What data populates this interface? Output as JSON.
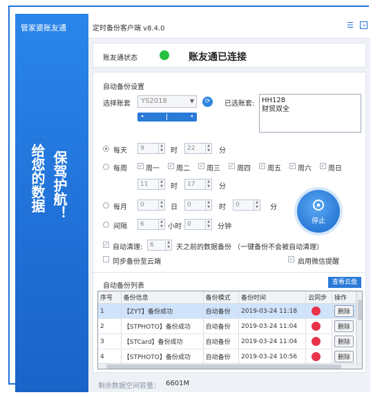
{
  "sidebar": {
    "brand": "管家婆账友通",
    "slogan_left": "给您的数据",
    "slogan_right": "保驾护航！"
  },
  "titlebar": {
    "title": "定时备份客户端 v8.4.0",
    "menu_icon": "menu-icon",
    "minimize_icon": "minimize-to-tray-icon"
  },
  "status": {
    "label": "账友通状态",
    "text": "账友通已连接",
    "color": "#27c03e"
  },
  "backup_settings": {
    "section_label": "自动备份设置",
    "select_account_label": "选择账套",
    "account_value": "YS2018",
    "selected_label": "已选账套:",
    "selected_accounts": [
      "HH128",
      "财贸双全"
    ],
    "daily": {
      "label": "每天",
      "hour": "9",
      "minute": "22",
      "hour_unit": "时",
      "minute_unit": "分"
    },
    "weekly": {
      "label": "每周",
      "days": [
        "周一",
        "周二",
        "周三",
        "周四",
        "周五",
        "周六",
        "周日"
      ],
      "hour": "11",
      "minute": "17",
      "hour_unit": "时",
      "minute_unit": "分"
    },
    "monthly": {
      "label": "每月",
      "day": "0",
      "hour": "0",
      "minute": "0",
      "day_unit": "日",
      "hour_unit": "时",
      "minute_unit": "分"
    },
    "interval": {
      "label": "间隔",
      "hours": "6",
      "minutes": "0",
      "hour_unit": "小时",
      "minute_unit": "分钟"
    },
    "auto_clean": {
      "label": "自动清理:",
      "days": "6",
      "suffix": "天之前的数据备份 （一键备份不会被自动清理）"
    },
    "sync_cloud_label": "同步备份至云端",
    "wechat_label": "启用微信提醒",
    "stop_button": "停止"
  },
  "backup_list": {
    "section_label": "自动备份列表",
    "cloud_button": "查看云盘",
    "columns": [
      "序号",
      "备份信息",
      "备份模式",
      "备份时间",
      "云同步",
      "操作"
    ],
    "rows": [
      {
        "no": "1",
        "info": "【ZYT】备份成功",
        "mode": "自动备份",
        "time": "2019-03-24 11:18",
        "action": "删除"
      },
      {
        "no": "2",
        "info": "【STPHOTO】备份成功",
        "mode": "自动备份",
        "time": "2019-03-24 11:04",
        "action": "删除"
      },
      {
        "no": "3",
        "info": "【STCard】备份成功",
        "mode": "自动备份",
        "time": "2019-03-24 11:04",
        "action": "删除"
      },
      {
        "no": "4",
        "info": "【STPHOTO】备份成功",
        "mode": "自动备份",
        "time": "2019-03-24 10:56",
        "action": "删除"
      }
    ],
    "sync_color": "#e8334a"
  },
  "footer": {
    "label": "剩余数据空间容量：",
    "value": "6601M"
  }
}
